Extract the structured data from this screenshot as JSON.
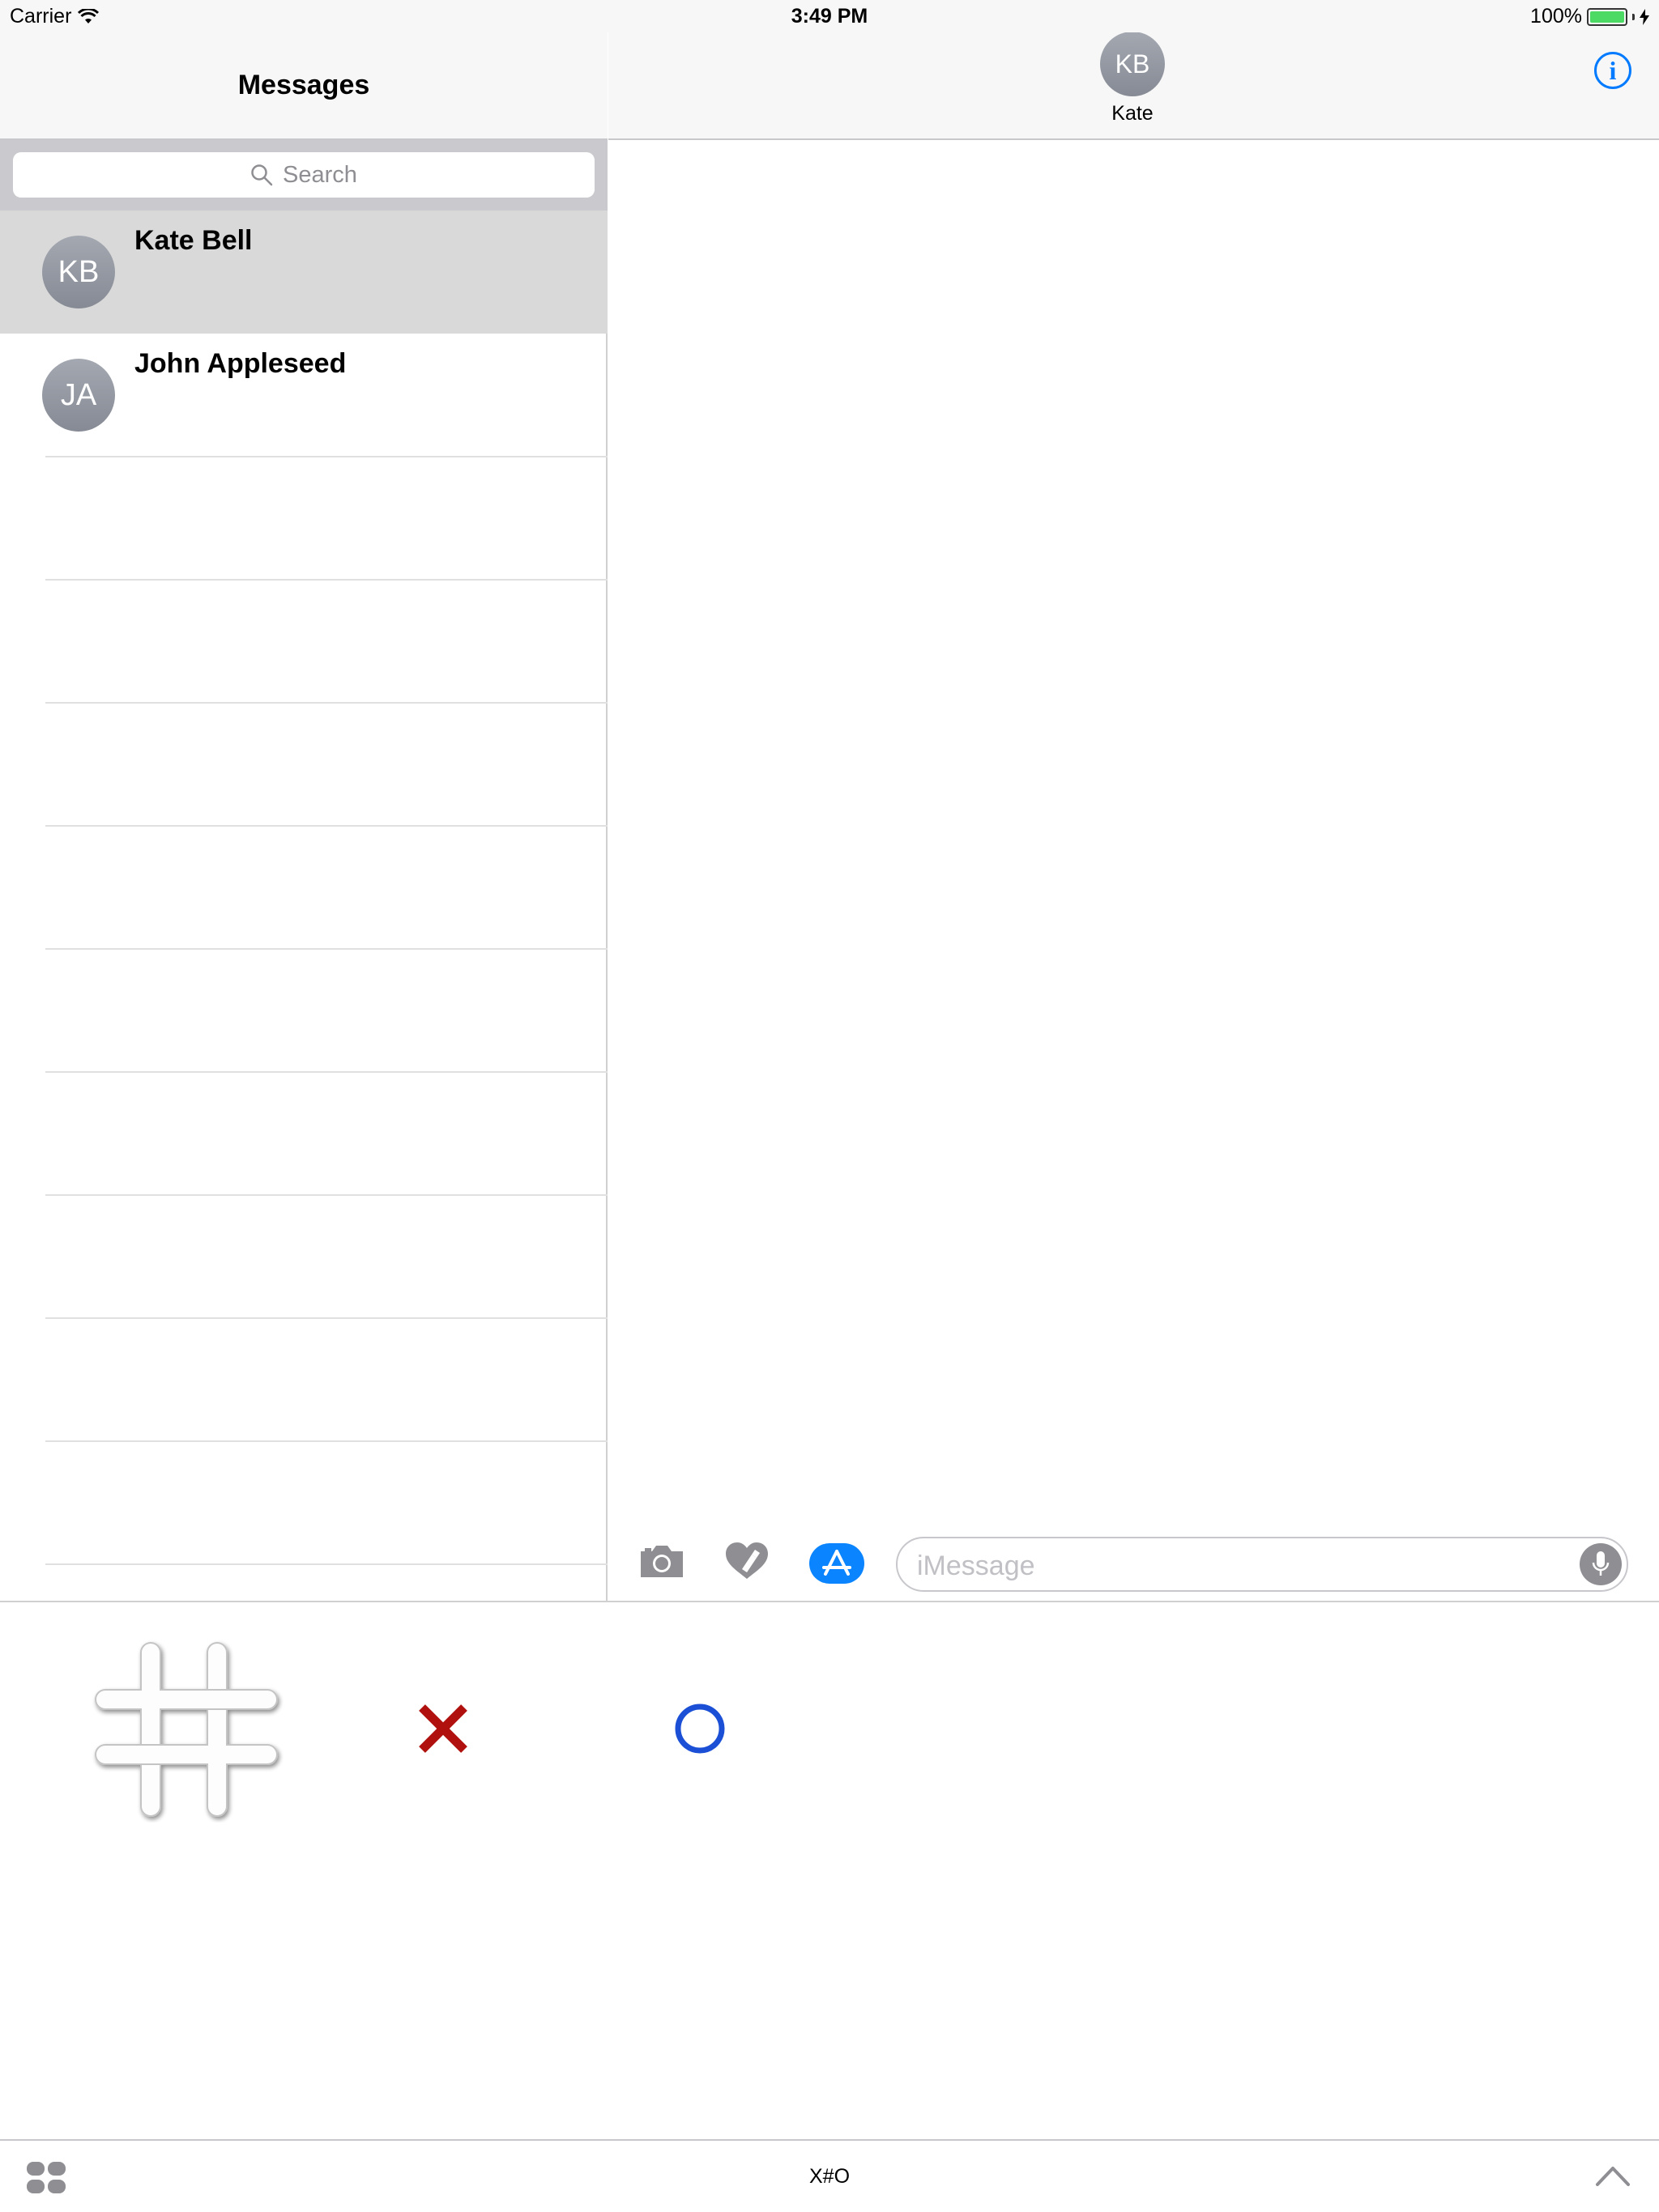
{
  "status_bar": {
    "carrier": "Carrier",
    "time": "3:49 PM",
    "battery": "100%"
  },
  "conversation_list": {
    "title": "Messages",
    "search_placeholder": "Search",
    "conversations": [
      {
        "initials": "KB",
        "name": "Kate Bell",
        "selected": true
      },
      {
        "initials": "JA",
        "name": "John Appleseed",
        "selected": false
      }
    ]
  },
  "conversation_header": {
    "avatar_initials": "KB",
    "name": "Kate"
  },
  "compose_bar": {
    "icons": [
      "camera-icon",
      "digital-touch-icon",
      "app-store-icon",
      "microphone-icon"
    ],
    "placeholder": "iMessage"
  },
  "extension": {
    "stickers": [
      "tic-tac-toe-board-sticker",
      "x-mark-sticker",
      "o-mark-sticker"
    ],
    "app_title": "X#O",
    "icons": [
      "app-drawer-icon",
      "expand-chevron-icon"
    ]
  },
  "colors": {
    "accent_blue": "#007aff",
    "selected_row": "#d9d9d9",
    "x_red": "#b0110e",
    "o_blue": "#1a4fd6",
    "battery_green": "#4cd964"
  }
}
